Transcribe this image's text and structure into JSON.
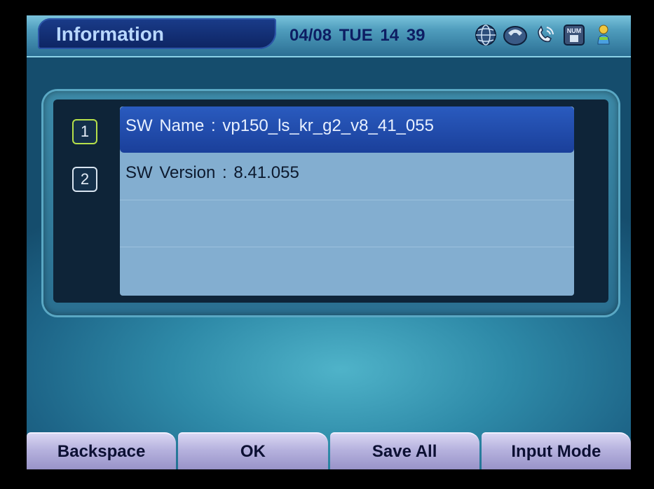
{
  "header": {
    "title": "Information",
    "datetime": "04/08  TUE  14  39",
    "status_icons": [
      "globe-icon",
      "phone-icon",
      "phone-ring-icon",
      "num-lock-icon",
      "person-icon"
    ],
    "num_label": "NUM"
  },
  "info_list": {
    "items": [
      {
        "number": "1",
        "text": "SW Name  :  vp150_ls_kr_g2_v8_41_055",
        "selected": true
      },
      {
        "number": "2",
        "text": "SW Version  :  8.41.055",
        "selected": false
      },
      {
        "number": "",
        "text": "",
        "selected": false
      },
      {
        "number": "",
        "text": "",
        "selected": false
      }
    ]
  },
  "softkeys": {
    "backspace": "Backspace",
    "ok": "OK",
    "save_all": "Save All",
    "input_mode": "Input Mode"
  },
  "colors": {
    "selection": "#1a3f9a",
    "active_number_border": "#b6e04a",
    "list_background": "#83aed0"
  }
}
